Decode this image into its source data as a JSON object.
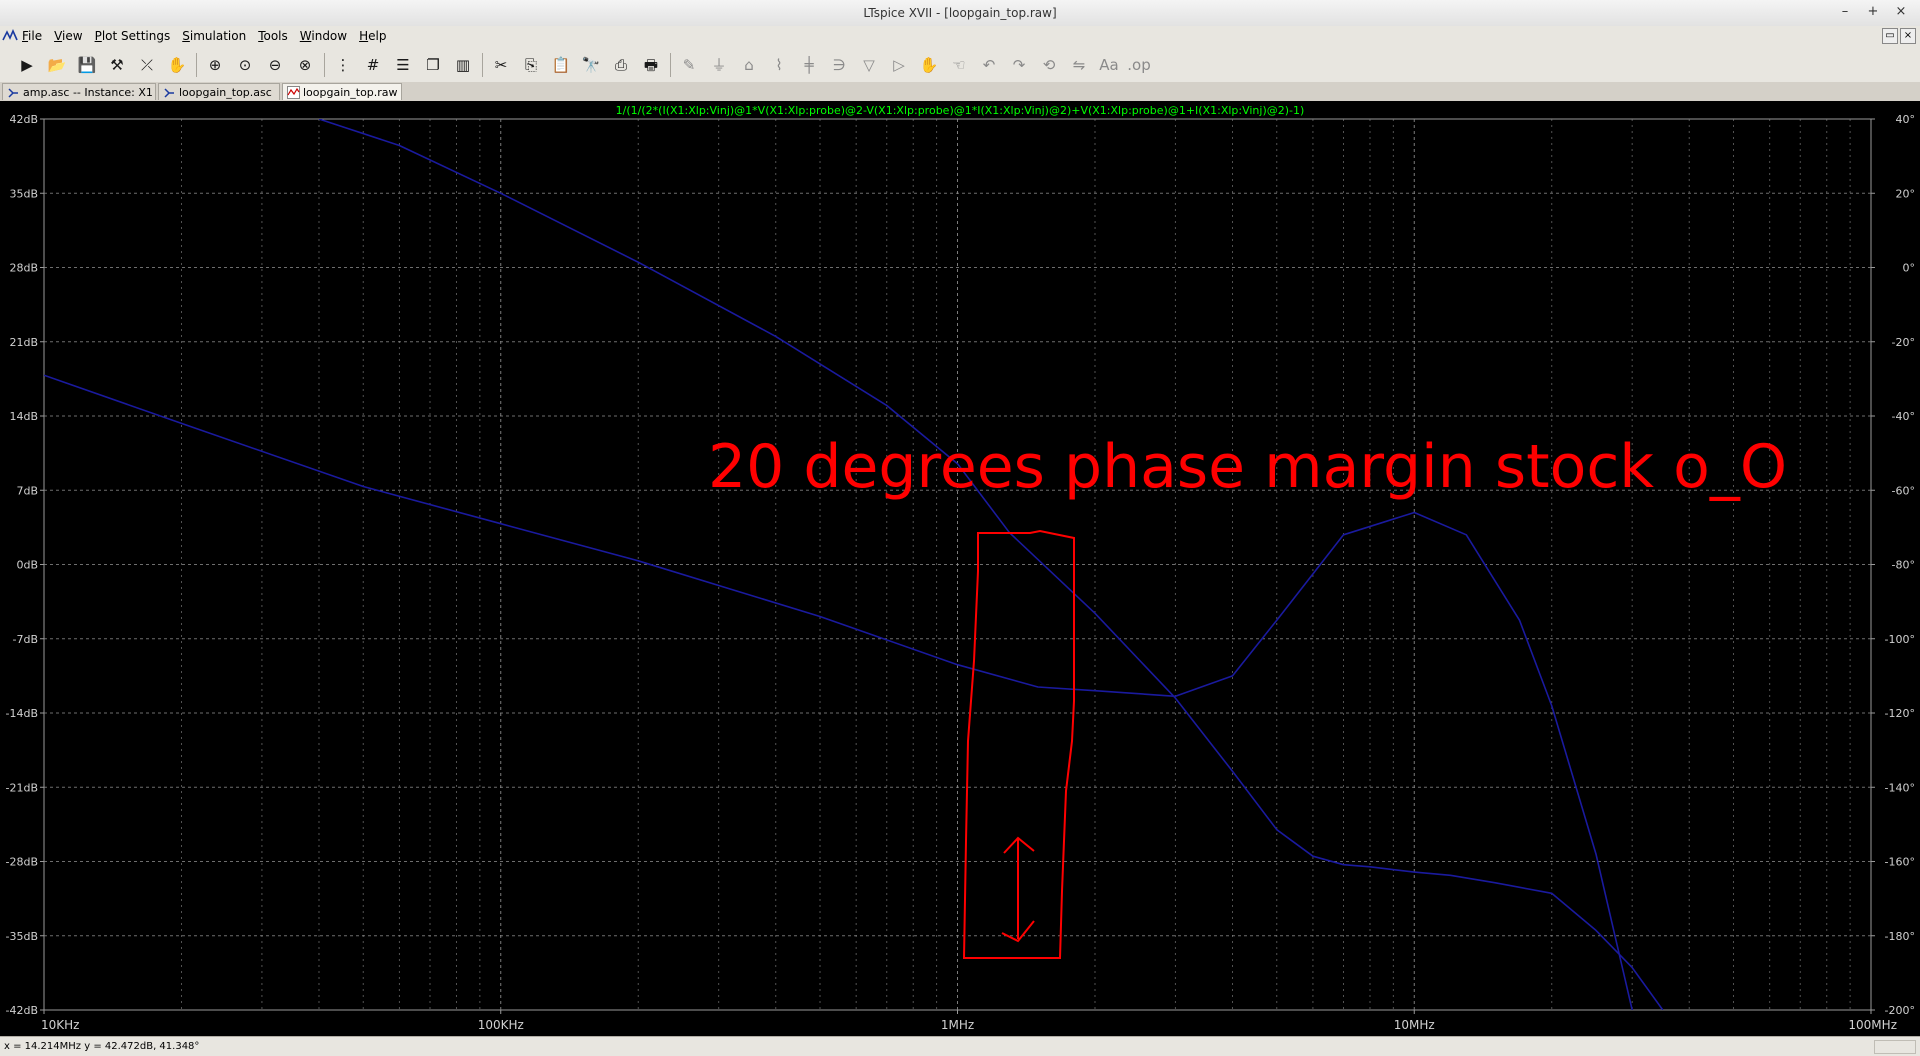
{
  "window": {
    "title": "LTspice XVII - [loopgain_top.raw]",
    "controls": {
      "minimize": "–",
      "maximize": "+",
      "close": "×"
    }
  },
  "menu": [
    "File",
    "View",
    "Plot Settings",
    "Simulation",
    "Tools",
    "Window",
    "Help"
  ],
  "toolbar_icons": [
    "run-icon",
    "open-icon",
    "save-icon",
    "control-panel-icon",
    "probe-icon",
    "pan-hand-icon",
    "zoom-in-icon",
    "zoom-area-icon",
    "zoom-out-icon",
    "zoom-fit-icon",
    "autorange-icon",
    "grid-icon",
    "tile-horizontal-icon",
    "cascade-icon",
    "tile-vertical-icon",
    "cut-icon",
    "copy-icon",
    "paste-icon",
    "find-icon",
    "print-setup-icon",
    "print-icon",
    "wire-icon",
    "ground-icon",
    "label-icon",
    "resistor-icon",
    "capacitor-icon",
    "inductor-icon",
    "diode-icon",
    "component-icon",
    "move-icon",
    "drag-icon",
    "undo-icon",
    "redo-icon",
    "rotate-icon",
    "mirror-icon",
    "text-icon",
    "spice-directive-icon"
  ],
  "tabs": [
    {
      "label": "amp.asc -- Instance: X1",
      "icon": "schematic-icon",
      "active": false
    },
    {
      "label": "loopgain_top.asc",
      "icon": "schematic-icon",
      "active": false
    },
    {
      "label": "loopgain_top.raw",
      "icon": "waveform-icon",
      "active": true
    }
  ],
  "chart_data": {
    "type": "line",
    "title": "1/(1/(2*(I(X1:Xlp:Vinj)@1*V(X1:Xlp:probe)@2-V(X1:Xlp:probe)@1*I(X1:Xlp:Vinj)@2)+V(X1:Xlp:probe)@1+I(X1:Xlp:Vinj)@2)-1)",
    "title_color": "#00ff00",
    "x_scale": "log",
    "xlim": [
      10000,
      100000000
    ],
    "x_ticks": [
      10000,
      100000,
      1000000,
      10000000,
      100000000
    ],
    "x_tick_labels": [
      "10KHz",
      "100KHz",
      "1MHz",
      "10MHz",
      "100MHz"
    ],
    "y_left_lim": [
      -42,
      42
    ],
    "y_left_ticks": [
      42,
      35,
      28,
      21,
      14,
      7,
      0,
      -7,
      -14,
      -21,
      -28,
      -35,
      -42
    ],
    "y_left_tick_labels": [
      "42dB",
      "35dB",
      "28dB",
      "21dB",
      "14dB",
      "7dB",
      "0dB",
      "-7dB",
      "-14dB",
      "-21dB",
      "-28dB",
      "-35dB",
      "-42dB"
    ],
    "y_right_lim": [
      -200,
      40
    ],
    "y_right_ticks": [
      40,
      20,
      0,
      -20,
      -40,
      -60,
      -80,
      -100,
      -120,
      -140,
      -160,
      -180,
      -200
    ],
    "y_right_tick_labels": [
      "40°",
      "20°",
      "0°",
      "-20°",
      "-40°",
      "-60°",
      "-80°",
      "-100°",
      "-120°",
      "-140°",
      "-160°",
      "-180°",
      "-200°"
    ],
    "grid": true,
    "trace_color": "#1a1a9e",
    "series": [
      {
        "axis": "left",
        "x": [
          40000,
          60000,
          100000,
          200000,
          400000,
          700000,
          1000000,
          1300000,
          2000000,
          3000000,
          4000000,
          5000000,
          6000000,
          7000000,
          8000000,
          10000000,
          12000000,
          15000000,
          20000000,
          25000000,
          30000000,
          35000000
        ],
        "y": [
          42,
          39.5,
          35,
          28.5,
          21.5,
          15,
          9.5,
          3,
          -4.6,
          -12.6,
          -19.5,
          -25,
          -27.5,
          -28.3,
          -28.5,
          -29,
          -29.3,
          -30,
          -31,
          -34.5,
          -38,
          -42
        ]
      },
      {
        "axis": "right",
        "x": [
          10000,
          20000,
          50000,
          100000,
          200000,
          500000,
          1000000,
          1500000,
          2000000,
          3000000,
          4000000,
          5000000,
          7000000,
          10000000,
          13000000,
          17000000,
          20000000,
          25000000,
          30000000
        ],
        "y": [
          -29,
          -42,
          -59,
          -69,
          -79,
          -94,
          -107,
          -113,
          -114,
          -115.5,
          -110,
          -95,
          -72,
          -66,
          -72,
          -95,
          -118,
          -158,
          -200
        ]
      }
    ],
    "annotation": {
      "text": "20 degrees phase margin stock o_O",
      "color": "#ff0000"
    }
  },
  "status": "x = 14.214MHz    y = 42.472dB, 41.348°"
}
